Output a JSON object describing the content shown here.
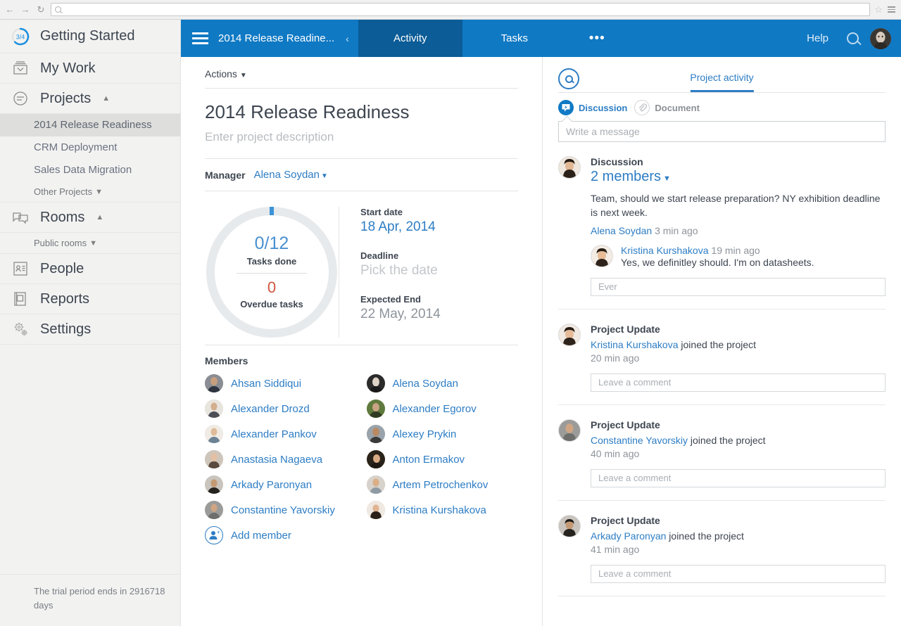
{
  "browser": {
    "back_icon": "arrow-left-icon",
    "forward_icon": "arrow-right-icon",
    "reload_icon": "reload-icon",
    "url_value": "",
    "url_placeholder": "",
    "bookmark_icon": "star-icon",
    "menu_icon": "hamburger-icon"
  },
  "sidebar": {
    "getting_started": {
      "label": "Getting Started",
      "progress": "3/4"
    },
    "items": [
      {
        "label": "My Work",
        "icon": "inbox-icon"
      },
      {
        "label": "Projects",
        "icon": "projects-icon",
        "caret": "⌃"
      },
      {
        "label": "Rooms",
        "icon": "rooms-icon",
        "caret": "⌃"
      },
      {
        "label": "People",
        "icon": "people-icon"
      },
      {
        "label": "Reports",
        "icon": "reports-icon"
      },
      {
        "label": "Settings",
        "icon": "gear-icon"
      }
    ],
    "projects": [
      {
        "label": "2014 Release Readiness",
        "selected": true
      },
      {
        "label": "CRM Deployment",
        "selected": false
      },
      {
        "label": "Sales Data Migration",
        "selected": false
      }
    ],
    "other_projects": "Other Projects",
    "public_rooms": "Public rooms",
    "trial_notice": "The trial period ends in 2916718 days"
  },
  "topbar": {
    "menu_icon": "hamburger-icon",
    "project_name": "2014 Release Readine...",
    "collapse_icon": "chevron-left-icon",
    "tabs": [
      {
        "label": "Activity",
        "active": true
      },
      {
        "label": "Tasks",
        "active": false
      }
    ],
    "more_label": "•••",
    "help_label": "Help",
    "search_icon": "search-icon",
    "avatar": "user-avatar",
    "bg_color": "#0f79c4",
    "active_tab_color": "#0b5c97"
  },
  "project": {
    "actions_label": "Actions",
    "title": "2014 Release Readiness",
    "description_placeholder": "Enter project description",
    "manager_label": "Manager",
    "manager_name": "Alena Soydan",
    "stats": {
      "tasks_done": "0/12",
      "tasks_done_label": "Tasks done",
      "overdue": "0",
      "overdue_label": "Overdue tasks",
      "progress_percent": 0,
      "ring_color": "#e7eaec",
      "tick_color": "#3b93d8",
      "done_color": "#4a90d0",
      "overdue_color": "#d0543f"
    },
    "dates": [
      {
        "label": "Start date",
        "value": "18 Apr, 2014",
        "style": "link"
      },
      {
        "label": "Deadline",
        "value": "Pick the date",
        "style": "placeholder"
      },
      {
        "label": "Expected End",
        "value": "22 May, 2014",
        "style": "grey"
      }
    ],
    "members_label": "Members",
    "members": [
      "Ahsan Siddiqui",
      "Alena Soydan",
      "Alexander Drozd",
      "Alexander Egorov",
      "Alexander Pankov",
      "Alexey Prykin",
      "Anastasia Nagaeva",
      "Anton Ermakov",
      "Arkady Paronyan",
      "Artem Petrochenkov",
      "Constantine Yavorskiy",
      "Kristina Kurshakova"
    ],
    "add_member_label": "Add member",
    "add_member_icon": "add-user-icon"
  },
  "activity": {
    "search_icon": "search-icon",
    "tab_label": "Project activity",
    "toggles": [
      {
        "label": "Discussion",
        "icon": "discussion-icon",
        "active": true
      },
      {
        "label": "Document",
        "icon": "paperclip-icon",
        "active": false
      }
    ],
    "message_placeholder": "Write a message",
    "feed": [
      {
        "type": "discussion",
        "title": "Discussion",
        "members_label": "2 members",
        "text": "Team, should we start release preparation? NY exhibition deadline is next week.",
        "author": "Alena Soydan",
        "time": "3 min ago",
        "reply": {
          "author": "Kristina Kurshakova",
          "time": "19 min ago",
          "text": "Yes, we definitley should. I'm on datasheets."
        },
        "comment_placeholder": "Ever"
      },
      {
        "type": "update",
        "title": "Project Update",
        "actor": "Kristina Kurshakova",
        "action": " joined the project",
        "time": "20 min ago",
        "comment_placeholder": "Leave a comment"
      },
      {
        "type": "update",
        "title": "Project Update",
        "actor": "Constantine Yavorskiy",
        "action": " joined the project",
        "time": "40 min ago",
        "comment_placeholder": "Leave a comment"
      },
      {
        "type": "update",
        "title": "Project Update",
        "actor": "Arkady Paronyan",
        "action": " joined the project",
        "time": "41 min ago",
        "comment_placeholder": "Leave a comment"
      }
    ]
  }
}
